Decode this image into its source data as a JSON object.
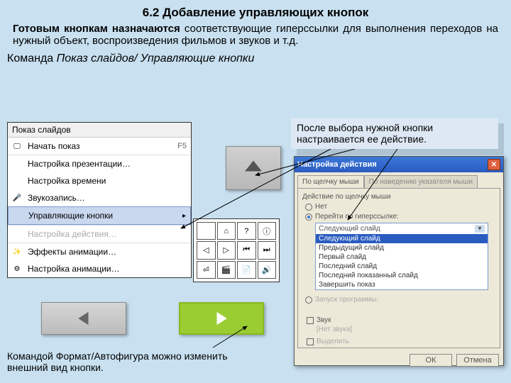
{
  "heading": "6.2 Добавление управляющих кнопок",
  "intro_bold_lead": "Готовым кнопкам назначаются ",
  "intro_rest": "соответствующие гиперссылки для выполнения переходов на нужный объект, воспроизведения фильмов и звуков и т.д.",
  "command_path_prefix": "Команда ",
  "command_path_italic": "Показ слайдов/ Управляющие кнопки",
  "menu": {
    "title": "Показ слайдов",
    "items": [
      {
        "icon": "🖵",
        "label": "Начать показ",
        "shortcut": "F5"
      },
      {
        "icon": "",
        "label": "Настройка презентации…"
      },
      {
        "icon": "",
        "label": "Настройка времени"
      },
      {
        "icon": "🎤",
        "label": "Звукозапись…"
      },
      {
        "icon": "",
        "label": "Управляющие кнопки",
        "submenu": true,
        "highlight": true
      },
      {
        "icon": "",
        "label": "Настройка действия…",
        "disabled": true
      },
      {
        "icon": "✨",
        "label": "Эффекты анимации…"
      },
      {
        "icon": "⚙",
        "label": "Настройка анимации…"
      }
    ]
  },
  "submenu_cells": [
    "",
    "⌂",
    "?",
    "ⓘ",
    "◁",
    "▷",
    "⏮",
    "⏭",
    "⏎",
    "🎬",
    "📄",
    "🔊"
  ],
  "sticky_note": "После выбора нужной кнопки настраивается ее действие.",
  "dialog": {
    "title": "Настройка действия",
    "tabs": [
      "По щелчку мыши",
      "По наведению указателя мыши"
    ],
    "section_label": "Действие по щелчку мыши",
    "radio_none": "Нет",
    "radio_hyperlink": "Перейти по гиперссылке:",
    "combo_selected": "Следующий слайд",
    "combo_options": [
      "Следующий слайд",
      "Предыдущий слайд",
      "Первый слайд",
      "Последний слайд",
      "Последний показанный слайд",
      "Завершить показ"
    ],
    "combo_hilite_index": 0,
    "radio_run": "Запуск программы:",
    "chk_sound": "Звук",
    "sound_value": "[Нет звука]",
    "chk_highlight": "Выделить",
    "ok": "ОК",
    "cancel": "Отмена"
  },
  "bottom_caption": "Командой Формат/Автофигура можно изменить внешний вид кнопки."
}
